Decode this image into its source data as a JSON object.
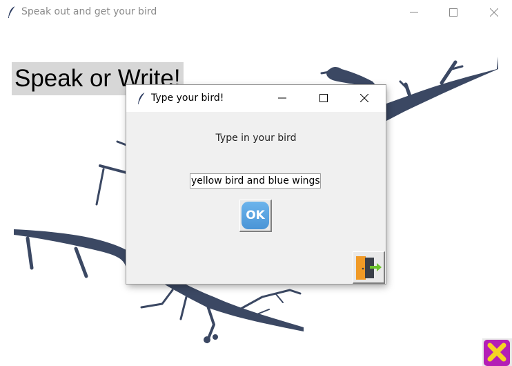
{
  "window": {
    "title": "Speak out and get your bird",
    "icon": "feather-icon"
  },
  "main": {
    "speak_label": "Speak or Write!",
    "background_image": "bird-on-branch-silhouette",
    "close_button_icon": "close-x-icon"
  },
  "dialog": {
    "title": "Type your bird!",
    "icon": "feather-icon",
    "prompt": "Type in your bird",
    "entry_value": "yellow bird and blue wings a",
    "ok_label": "OK",
    "exit_icon": "exit-door-icon"
  },
  "colors": {
    "branch": "#3b4863",
    "ok_button": "#5aa5e2",
    "close_button_bg": "#b41fb6",
    "close_button_x": "#f5d423",
    "door": "#f09a26",
    "arrow": "#6cc42c"
  }
}
